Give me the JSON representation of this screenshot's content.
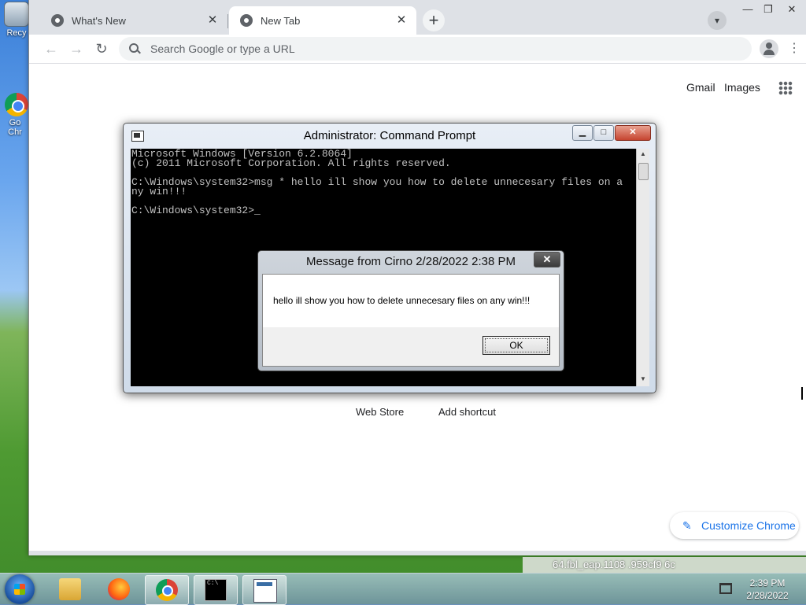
{
  "desktop": {
    "icons": [
      {
        "label": "Recy",
        "icon": "recycle-bin-icon"
      },
      {
        "label": "Go Chr",
        "icon": "chrome-icon"
      }
    ]
  },
  "browser": {
    "tabs": [
      {
        "title": "What's New",
        "active": false
      },
      {
        "title": "New Tab",
        "active": true
      }
    ],
    "new_tab_symbol": "+",
    "tab_close_symbol": "✕",
    "window_controls": {
      "minimize": "—",
      "maximize": "❐",
      "close": "✕"
    },
    "omnibox": {
      "placeholder": "Search Google or type a URL",
      "value": ""
    },
    "ntp": {
      "links": [
        "Gmail",
        "Images"
      ],
      "shortcuts": [
        "Web Store",
        "Add shortcut"
      ],
      "customize_label": "Customize Chrome"
    }
  },
  "cmd": {
    "title": "Administrator: Command Prompt",
    "lines": "Microsoft Windows [Version 6.2.8064]\n(c) 2011 Microsoft Corporation. All rights reserved.\n\nC:\\Windows\\system32>msg * hello ill show you how to delete unnecesary files on a\nny win!!!\n\nC:\\Windows\\system32>_"
  },
  "message_box": {
    "title": "Message from Cirno 2/28/2022 2:38 PM",
    "text": "hello ill show you how to delete unnecesary files on any win!!!",
    "ok_label": "OK",
    "close_symbol": "✕"
  },
  "taskbar": {
    "items": [
      "windows-explorer-icon",
      "firefox-icon",
      "chrome-icon",
      "command-prompt-icon",
      "window-icon"
    ],
    "clock_time": "2:39 PM",
    "clock_date": "2/28/2022",
    "background_text": "64.fbl_eap.1108 .959cf9 6c"
  },
  "colors": {
    "chrome_tab_bg": "#dee1e6",
    "chrome_link_blue": "#1a73e8",
    "cmd_text": "#c0c0c0",
    "cmd_close_red": "#c64430"
  }
}
